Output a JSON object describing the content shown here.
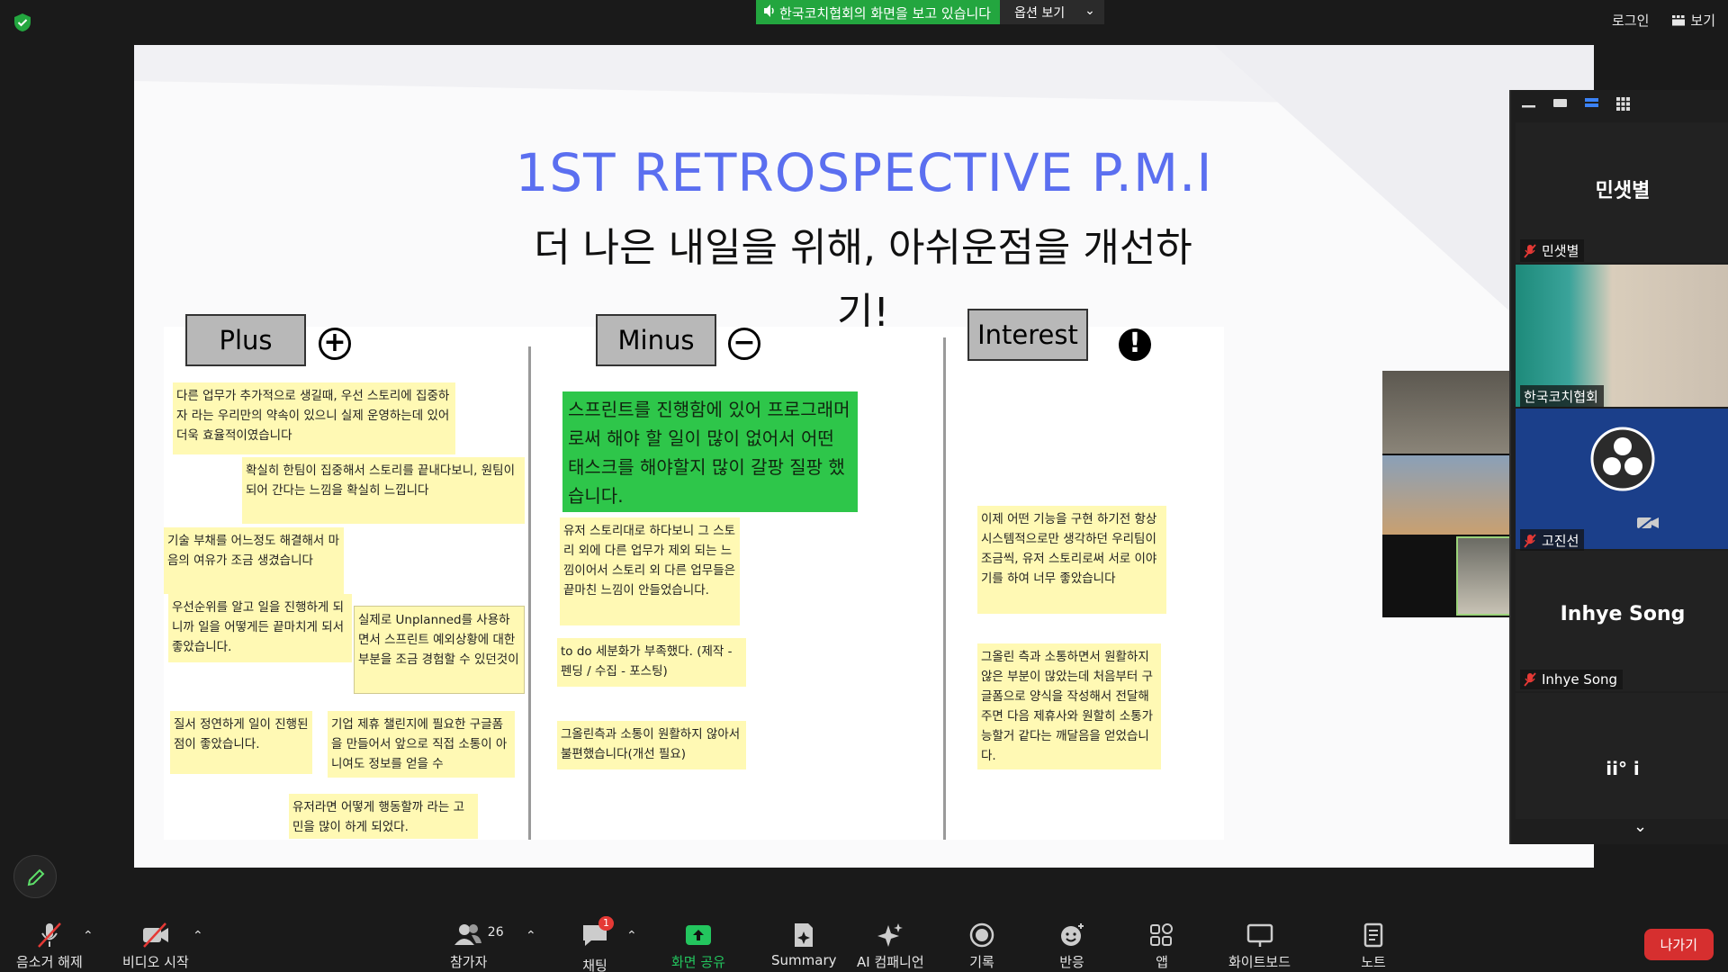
{
  "top": {
    "share_text": "한국코치협회의 화면을 보고 있습니다",
    "options_label": "옵션 보기",
    "login": "로그인",
    "view": "보기"
  },
  "slide": {
    "title": "1ST RETROSPECTIVE P.M.I",
    "subtitle": "더 나은 내일을 위해, 아쉬운점을 개선하기!",
    "columns": {
      "plus": "Plus",
      "minus": "Minus",
      "interest": "Interest"
    },
    "symbols": {
      "plus": "+",
      "minus": "−",
      "interest": "!"
    },
    "plus_notes": [
      "다른 업무가 추가적으로 생길때, 우선 스토리에 집중하자 라는 우리만의 약속이 있으니 실제 운영하는데 있어 더욱 효율적이였습니다",
      "확실히 한팀이 집중해서 스토리를 끝내다보니, 원팀이 되어 간다는 느낌을 확실히 느낍니다",
      "기술 부채를 어느정도 해결해서 마음의 여유가 조금 생겼습니다",
      "우선순위를 알고 일을 진행하게 되니까 일을 어떻게든 끝마치게 되서 좋았습니다.",
      "실제로 Unplanned를 사용하면서 스프린트 예외상황에 대한 부분을 조금 경험할 수 있던것이",
      "질서 정연하게 일이 진행된 점이 좋았습니다.",
      "기업 제휴 챌린지에 필요한 구글폼을 만들어서 앞으로 직접 소통이 아니여도 정보를 얻을 수",
      "유저라면 어떻게 행동할까 라는 고민을 많이 하게 되었다."
    ],
    "minus_notes": [
      "스프린트를 진행함에 있어 프로그래머로써 해야 할 일이 많이 없어서 어떤 태스크를 해야할지 많이 갈팡 질팡 했습니다.",
      "유저 스토리대로 하다보니 그 스토리 외에 다른 업무가 제외 되는 느낌이어서 스토리 외 다른 업무들은 끝마친 느낌이 안들었습니다.",
      "to do 세분화가 부족했다. (제작 - 펜딩 / 수집 - 포스팅)",
      "그올린측과 소통이 원활하지 않아서 불편했습니다(개선 필요)"
    ],
    "interest_notes": [
      "이제 어떤 기능을 구현 하기전 항상 시스템적으로만 생각하던 우리팀이 조금씩, 유저 스토리로써 서로 이야기를 하여 너무 좋았습니다",
      "그올린 측과 소통하면서 원활하지 않은 부분이 많았는데 처음부터 구글폼으로 양식을 작성해서 전달해주면 다음 제휴사와 원할히 소통가능할거 같다는 깨달음을 얻었습니다."
    ]
  },
  "panel": {
    "participants": [
      {
        "display_name": "민샛별",
        "label": "민샛별"
      },
      {
        "display_name": "",
        "label": "한국코치협회"
      },
      {
        "display_name": "",
        "label": "고진선"
      },
      {
        "display_name": "Inhye Song",
        "label": "Inhye Song"
      },
      {
        "display_name": "ii° i",
        "label": ""
      }
    ]
  },
  "toolbar": {
    "mute": "음소거 해제",
    "video": "비디오 시작",
    "participants": "참가자",
    "participants_count": "26",
    "chat": "채팅",
    "chat_badge": "1",
    "share": "화면 공유",
    "summary": "Summary",
    "ai": "AI 컴패니언",
    "record": "기록",
    "reactions": "반응",
    "apps": "앱",
    "whiteboard": "화이트보드",
    "notes": "노트",
    "leave": "나가기"
  },
  "colors": {
    "share_green": "#23a63f",
    "title_blue": "#5b6ff0",
    "sticky_yellow": "#fff9b4",
    "sticky_green": "#2ec64a",
    "leave_red": "#d62f2f"
  }
}
